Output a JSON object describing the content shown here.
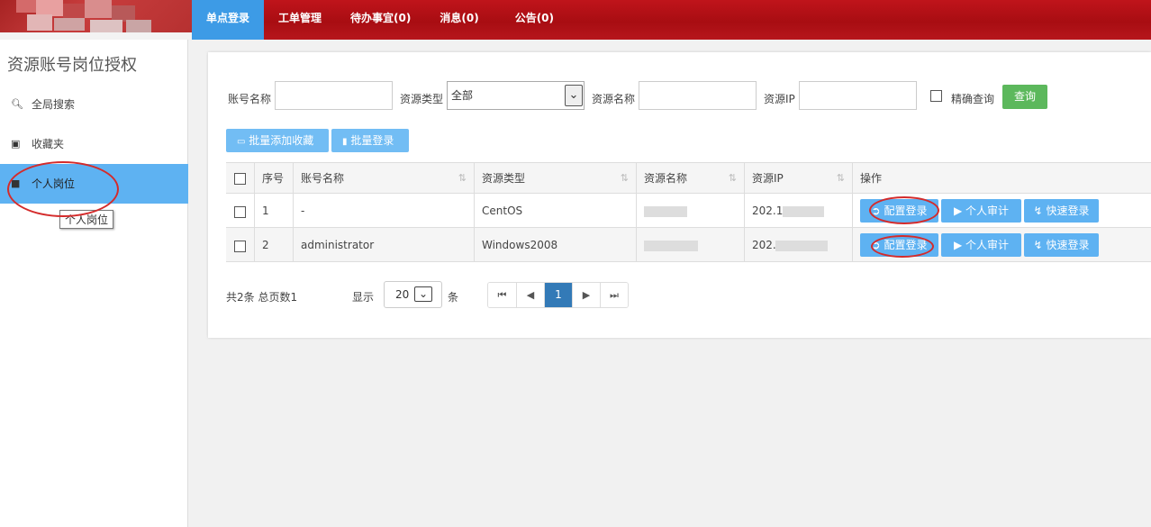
{
  "nav": {
    "items": [
      {
        "label": "单点登录",
        "active": true
      },
      {
        "label": "工单管理",
        "active": false
      },
      {
        "label": "待办事宜(0)",
        "active": false
      },
      {
        "label": "消息(0)",
        "active": false
      },
      {
        "label": "公告(0)",
        "active": false
      }
    ]
  },
  "sidebar": {
    "title": "资源账号岗位授权",
    "items": [
      {
        "label": "全局搜索",
        "icon": "search-icon"
      },
      {
        "label": "收藏夹",
        "icon": "briefcase-icon"
      },
      {
        "label": "个人岗位",
        "icon": "folder-icon",
        "active": true
      }
    ],
    "tooltip": "个人岗位"
  },
  "filters": {
    "account_name_label": "账号名称",
    "account_name_value": "",
    "resource_type_label": "资源类型",
    "resource_type_value": "全部",
    "resource_name_label": "资源名称",
    "resource_name_value": "",
    "resource_ip_label": "资源IP",
    "resource_ip_value": "",
    "exact_label": "精确查询",
    "exact_checked": false,
    "query_button": "查询"
  },
  "toolbar": {
    "batch_favorite": "批量添加收藏",
    "batch_login": "批量登录"
  },
  "table": {
    "headers": [
      "序号",
      "账号名称",
      "资源类型",
      "资源名称",
      "资源IP",
      "操作"
    ],
    "rows": [
      {
        "index": "1",
        "account": "-",
        "type": "CentOS",
        "ip_prefix": "202.1"
      },
      {
        "index": "2",
        "account": "administrator",
        "type": "Windows2008",
        "ip_prefix": "202."
      }
    ],
    "actions": [
      "配置登录",
      "个人审计",
      "快速登录"
    ]
  },
  "pagination": {
    "summary": "共2条 总页数1",
    "show_label": "显示",
    "page_size": "20",
    "unit": "条",
    "current_page": "1"
  },
  "colors": {
    "header_red": "#b3141a",
    "nav_active": "#3d9be6",
    "sidebar_active": "#5eb2f2",
    "query_green": "#5cb85c",
    "action_blue": "#5eb2f2",
    "page_active": "#337ab7",
    "annotation_red": "#d42b2b"
  }
}
